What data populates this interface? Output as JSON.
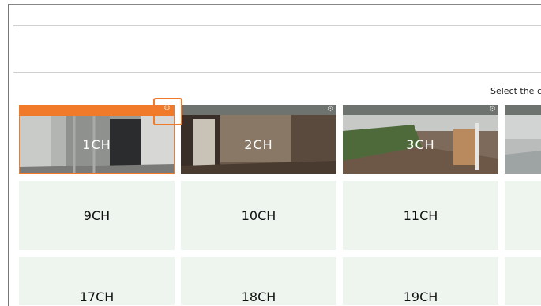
{
  "header": {
    "select_text": "Select the c"
  },
  "colors": {
    "accent": "#f07a2a",
    "tile_header": "#6f7370",
    "empty_tile": "#eef5ee"
  },
  "cameras": [
    {
      "label": "1CH",
      "selected": true,
      "icon": "gear-icon"
    },
    {
      "label": "2CH",
      "selected": false,
      "icon": "gear-icon"
    },
    {
      "label": "3CH",
      "selected": false,
      "icon": "gear-icon"
    },
    {
      "label": "",
      "selected": false,
      "icon": "gear-icon"
    }
  ],
  "rows": [
    {
      "labels": [
        "9CH",
        "10CH",
        "11CH"
      ]
    },
    {
      "labels": [
        "17CH",
        "18CH",
        "19CH"
      ]
    }
  ]
}
